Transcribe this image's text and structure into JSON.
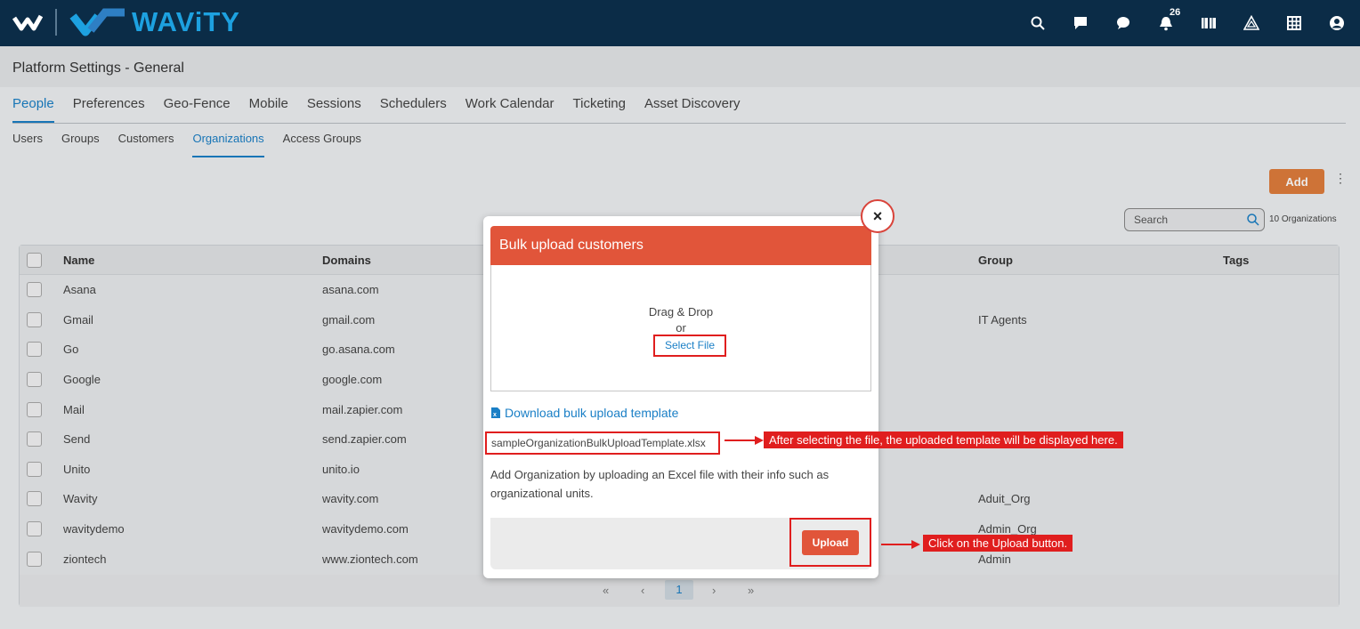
{
  "app": {
    "brand": "WAViTY",
    "notification_count": "26"
  },
  "page": {
    "title": "Platform Settings - General"
  },
  "main_tabs": [
    "People",
    "Preferences",
    "Geo-Fence",
    "Mobile",
    "Sessions",
    "Schedulers",
    "Work Calendar",
    "Ticketing",
    "Asset Discovery"
  ],
  "sub_tabs": [
    "Users",
    "Groups",
    "Customers",
    "Organizations",
    "Access Groups"
  ],
  "toolbar": {
    "add_label": "Add",
    "search_placeholder": "Search",
    "count_label": "10 Organizations"
  },
  "table": {
    "columns": {
      "name": "Name",
      "domains": "Domains",
      "group": "Group",
      "tags": "Tags"
    },
    "rows": [
      {
        "name": "Asana",
        "domain": "asana.com",
        "group": ""
      },
      {
        "name": "Gmail",
        "domain": "gmail.com",
        "group": "IT Agents"
      },
      {
        "name": "Go",
        "domain": "go.asana.com",
        "group": ""
      },
      {
        "name": "Google",
        "domain": "google.com",
        "group": ""
      },
      {
        "name": "Mail",
        "domain": "mail.zapier.com",
        "group": ""
      },
      {
        "name": "Send",
        "domain": "send.zapier.com",
        "group": ""
      },
      {
        "name": "Unito",
        "domain": "unito.io",
        "group": ""
      },
      {
        "name": "Wavity",
        "domain": "wavity.com",
        "group": "Aduit_Org"
      },
      {
        "name": "wavitydemo",
        "domain": "wavitydemo.com",
        "group": "Admin_Org"
      },
      {
        "name": "ziontech",
        "domain": "www.ziontech.com",
        "group": "Admin"
      }
    ]
  },
  "pagination": {
    "first": "«",
    "prev": "‹",
    "current": "1",
    "next": "›",
    "last": "»"
  },
  "modal": {
    "title": "Bulk upload customers",
    "close": "×",
    "drag_drop": "Drag & Drop",
    "or": "or",
    "select_file": "Select File",
    "download_link": "Download bulk upload template",
    "file_name": "sampleOrganizationBulkUploadTemplate.xlsx",
    "description": "Add Organization by uploading an Excel file with their info such as organizational units.",
    "upload": "Upload"
  },
  "callouts": {
    "file": "After selecting the file, the uploaded template will be displayed here.",
    "upload": "Click on the Upload button."
  },
  "colors": {
    "topbar": "#0b2c47",
    "brand": "#1da1e0",
    "accent": "#e1553a",
    "link": "#1a7fc6",
    "add_button": "#e07d3c",
    "callout": "#e01e1e"
  },
  "icons": [
    "search-icon",
    "chat-icon",
    "message-icon",
    "bell-icon",
    "book-icon",
    "warning-icon",
    "grid-icon",
    "user-icon",
    "excel-file-icon"
  ]
}
